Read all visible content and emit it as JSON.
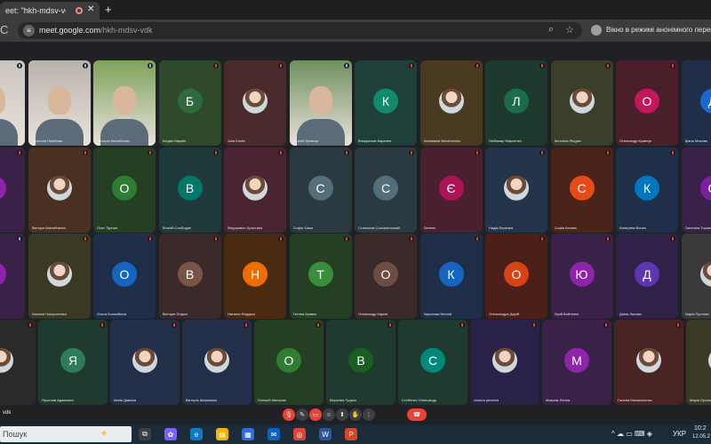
{
  "browser": {
    "tab_title": "eet: \"hkh-mdsv-vdk\"",
    "tab_close_glyph": "✕",
    "new_tab_glyph": "+",
    "reload_glyph": "C",
    "url_main": "meet.google.com",
    "url_path": "/hkh-mdsv-vdk",
    "incognito_label": "Вікно в режимі анонімного перегляду"
  },
  "meeting": {
    "code": "vdk",
    "controls": [
      {
        "name": "mic",
        "glyph": "🎙",
        "state": "red"
      },
      {
        "name": "camera",
        "glyph": "✎",
        "state": "normal"
      },
      {
        "name": "captions",
        "glyph": "▭",
        "state": "red"
      },
      {
        "name": "emoji",
        "glyph": "☺",
        "state": "normal"
      },
      {
        "name": "present",
        "glyph": "⬆",
        "state": "normal"
      },
      {
        "name": "hand",
        "glyph": "✋",
        "state": "normal"
      },
      {
        "name": "more",
        "glyph": "⋮",
        "state": "normal"
      },
      {
        "name": "leave",
        "glyph": "☎",
        "state": "end"
      }
    ]
  },
  "participants": [
    {
      "row": 0,
      "col": 0,
      "name": "",
      "kind": "video",
      "bg": "#c9c4bd",
      "mic": "active"
    },
    {
      "row": 0,
      "col": 1,
      "name": "Анатолія Палійова",
      "kind": "video",
      "bg": "#b9b3ab",
      "mic": "active"
    },
    {
      "row": 0,
      "col": 2,
      "name": "Вікторія Михайлова",
      "kind": "video",
      "bg": "#7fa25a",
      "mic": "active"
    },
    {
      "row": 0,
      "col": 3,
      "name": "Богдан Кармін",
      "kind": "letter",
      "letter": "Б",
      "bg": "#2e4a2a",
      "avatar": "#2d6a3e",
      "mic": "muted"
    },
    {
      "row": 0,
      "col": 4,
      "name": "Julia Kostiv",
      "kind": "photo",
      "bg": "#4a2a2a",
      "mic": "muted"
    },
    {
      "row": 0,
      "col": 5,
      "name": "Віталій Кравчук",
      "kind": "video",
      "bg": "#6f8f5e",
      "mic": "active"
    },
    {
      "row": 0,
      "col": 6,
      "name": "Владислав Каралев",
      "kind": "letter",
      "letter": "К",
      "bg": "#1f3f3a",
      "avatar": "#128a6e",
      "mic": "muted"
    },
    {
      "row": 0,
      "col": 7,
      "name": "Anastasiia Nevdovenko",
      "kind": "photo",
      "bg": "#4a3a22",
      "mic": "muted"
    },
    {
      "row": 0,
      "col": 8,
      "name": "Любомир Марченко",
      "kind": "letter",
      "letter": "Л",
      "bg": "#1e3a2e",
      "avatar": "#1d6b4d",
      "mic": "muted"
    },
    {
      "row": 0,
      "col": 9,
      "name": "Ангеліна Ліщука",
      "kind": "photo",
      "bg": "#3a3f2a",
      "mic": "muted"
    },
    {
      "row": 0,
      "col": 10,
      "name": "Олександр Кравчук",
      "kind": "letter",
      "letter": "О",
      "bg": "#4a1f2a",
      "avatar": "#c2185b",
      "mic": "muted"
    },
    {
      "row": 0,
      "col": 11,
      "name": "Діана Мохова",
      "kind": "letter",
      "letter": "Д",
      "bg": "#1f2f4a",
      "avatar": "#1967d2",
      "mic": "muted"
    },
    {
      "row": 1,
      "col": 0,
      "name": "",
      "kind": "letter",
      "letter": "",
      "bg": "#3a2148",
      "avatar": "#8e24aa",
      "mic": "muted"
    },
    {
      "row": 1,
      "col": 1,
      "name": "Вікторія Матвійченко",
      "kind": "photo",
      "bg": "#4a3020",
      "mic": "muted"
    },
    {
      "row": 1,
      "col": 2,
      "name": "Олег Турчин",
      "kind": "letter",
      "letter": "О",
      "bg": "#243f24",
      "avatar": "#2e7d32",
      "mic": "muted"
    },
    {
      "row": 1,
      "col": 3,
      "name": "Віталій Слободин",
      "kind": "letter",
      "letter": "В",
      "bg": "#1f3a3a",
      "avatar": "#00796b",
      "mic": "muted"
    },
    {
      "row": 1,
      "col": 4,
      "name": "Федорович Христина",
      "kind": "photo",
      "bg": "#4a2430",
      "mic": "muted"
    },
    {
      "row": 1,
      "col": 5,
      "name": "Софія Хома",
      "kind": "letter",
      "letter": "С",
      "bg": "#2a3a40",
      "avatar": "#546e7a",
      "mic": "muted"
    },
    {
      "row": 1,
      "col": 6,
      "name": "Станіслав Соломенський",
      "kind": "letter",
      "letter": "С",
      "bg": "#2a3a40",
      "avatar": "#546e7a",
      "mic": "muted"
    },
    {
      "row": 1,
      "col": 7,
      "name": "Євгенія",
      "kind": "letter",
      "letter": "Є",
      "bg": "#4a1f30",
      "avatar": "#ad1457",
      "mic": "muted"
    },
    {
      "row": 1,
      "col": 8,
      "name": "Надія Березюк",
      "kind": "photo",
      "bg": "#24344a",
      "mic": "muted"
    },
    {
      "row": 1,
      "col": 9,
      "name": "Софія Кесинь",
      "kind": "letter",
      "letter": "С",
      "bg": "#4a2418",
      "avatar": "#e64a19",
      "mic": "muted"
    },
    {
      "row": 1,
      "col": 10,
      "name": "Катерина Влнич",
      "kind": "letter",
      "letter": "К",
      "bg": "#1f2f4a",
      "avatar": "#0277bd",
      "mic": "muted"
    },
    {
      "row": 1,
      "col": 11,
      "name": "Світлана Торшенко",
      "kind": "letter",
      "letter": "С",
      "bg": "#3a2148",
      "avatar": "#7b1fa2",
      "mic": "muted"
    },
    {
      "row": 2,
      "col": 0,
      "name": "",
      "kind": "letter",
      "letter": "",
      "bg": "#3a2148",
      "avatar": "#8e24aa",
      "mic": "active"
    },
    {
      "row": 2,
      "col": 1,
      "name": "Наталія Чопоротенко",
      "kind": "photo",
      "bg": "#3a3a24",
      "mic": "muted"
    },
    {
      "row": 2,
      "col": 2,
      "name": "Ольга Коломбина",
      "kind": "letter",
      "letter": "О",
      "bg": "#1f2f4a",
      "avatar": "#1565c0",
      "mic": "muted"
    },
    {
      "row": 2,
      "col": 3,
      "name": "Вікторія Огарко",
      "kind": "letter",
      "letter": "В",
      "bg": "#3a2a2a",
      "avatar": "#795548",
      "mic": "muted"
    },
    {
      "row": 2,
      "col": 4,
      "name": "Наталія Федурко",
      "kind": "letter",
      "letter": "Н",
      "bg": "#4a2a10",
      "avatar": "#ef6c00",
      "mic": "muted"
    },
    {
      "row": 2,
      "col": 5,
      "name": "Тетяна Кравек",
      "kind": "letter",
      "letter": "Т",
      "bg": "#243f24",
      "avatar": "#388e3c",
      "mic": "muted"
    },
    {
      "row": 2,
      "col": 6,
      "name": "Олександр Карпів",
      "kind": "letter",
      "letter": "О",
      "bg": "#3a2a2a",
      "avatar": "#6d4c41",
      "mic": "muted"
    },
    {
      "row": 2,
      "col": 7,
      "name": "Кирилова Woroid",
      "kind": "letter",
      "letter": "К",
      "bg": "#1f2f4a",
      "avatar": "#1565c0",
      "mic": "muted"
    },
    {
      "row": 2,
      "col": 8,
      "name": "Олександра Дарій",
      "kind": "letter",
      "letter": "О",
      "bg": "#4a2018",
      "avatar": "#d84315",
      "mic": "muted"
    },
    {
      "row": 2,
      "col": 9,
      "name": "Юрій Войтенко",
      "kind": "letter",
      "letter": "Ю",
      "bg": "#3a2148",
      "avatar": "#8e24aa",
      "mic": "muted"
    },
    {
      "row": 2,
      "col": 10,
      "name": "Діана Ляхова",
      "kind": "letter",
      "letter": "Д",
      "bg": "#2f2148",
      "avatar": "#5e35b1",
      "mic": "muted"
    },
    {
      "row": 2,
      "col": 11,
      "name": "Марія Пустова",
      "kind": "photo",
      "bg": "#3a3a3a",
      "mic": "muted"
    },
    {
      "row": 3,
      "col": 0,
      "name": "",
      "kind": "photo",
      "bg": "#2a2a2a",
      "mic": "muted"
    },
    {
      "row": 3,
      "col": 1,
      "name": "Ярослав Адамович",
      "kind": "letter",
      "letter": "Я",
      "bg": "#1f3a2e",
      "avatar": "#2e7d5a",
      "mic": "muted"
    },
    {
      "row": 3,
      "col": 2,
      "name": "Маня Давкіна",
      "kind": "photo",
      "bg": "#24304a",
      "mic": "muted"
    },
    {
      "row": 3,
      "col": 3,
      "name": "Вікторія Шерманко",
      "kind": "photo",
      "bg": "#24304a",
      "mic": "muted"
    },
    {
      "row": 3,
      "col": 4,
      "name": "Олексій Мельник",
      "kind": "letter",
      "letter": "О",
      "bg": "#243f24",
      "avatar": "#2e7d32",
      "mic": "muted"
    },
    {
      "row": 3,
      "col": 5,
      "name": "Вероніка Гуцаль",
      "kind": "letter",
      "letter": "В",
      "bg": "#1f3a2e",
      "avatar": "#1b5e20",
      "mic": "muted"
    },
    {
      "row": 3,
      "col": 6,
      "name": "Стебенко Олександр",
      "kind": "letter",
      "letter": "С",
      "bg": "#1f3a2e",
      "avatar": "#00897b",
      "mic": "muted"
    },
    {
      "row": 3,
      "col": 7,
      "name": "victoria pechera",
      "kind": "photo",
      "bg": "#2a2148",
      "mic": "muted"
    },
    {
      "row": 3,
      "col": 8,
      "name": "Максим Яхнюк",
      "kind": "letter",
      "letter": "М",
      "bg": "#3a2148",
      "avatar": "#8e24aa",
      "mic": "muted"
    },
    {
      "row": 3,
      "col": 9,
      "name": "Галина Михальченко",
      "kind": "photo",
      "bg": "#4a2424",
      "mic": "muted"
    },
    {
      "row": 3,
      "col": 10,
      "name": "Марія Орлякова",
      "kind": "photo",
      "bg": "#3a3a24",
      "mic": "muted"
    }
  ],
  "taskbar": {
    "search_placeholder": "Пошук",
    "apps": [
      {
        "name": "task-view",
        "glyph": "⧉",
        "color": "#3c4043"
      },
      {
        "name": "widgets",
        "glyph": "✿",
        "color": "#7b61ff"
      },
      {
        "name": "edge",
        "glyph": "e",
        "color": "#0e7ac4"
      },
      {
        "name": "explorer",
        "glyph": "▤",
        "color": "#f4b400"
      },
      {
        "name": "store",
        "glyph": "▦",
        "color": "#2d6fd6"
      },
      {
        "name": "mail",
        "glyph": "✉",
        "color": "#0a64c2"
      },
      {
        "name": "chrome",
        "glyph": "◎",
        "color": "#db4437"
      },
      {
        "name": "word",
        "glyph": "W",
        "color": "#2b579a"
      },
      {
        "name": "powerpoint",
        "glyph": "P",
        "color": "#d24726"
      }
    ],
    "tray_icons": "^  ☁  ▭  ⌨  ◈",
    "lang": "УКР",
    "time": "10:2",
    "date": "12.05.2"
  }
}
